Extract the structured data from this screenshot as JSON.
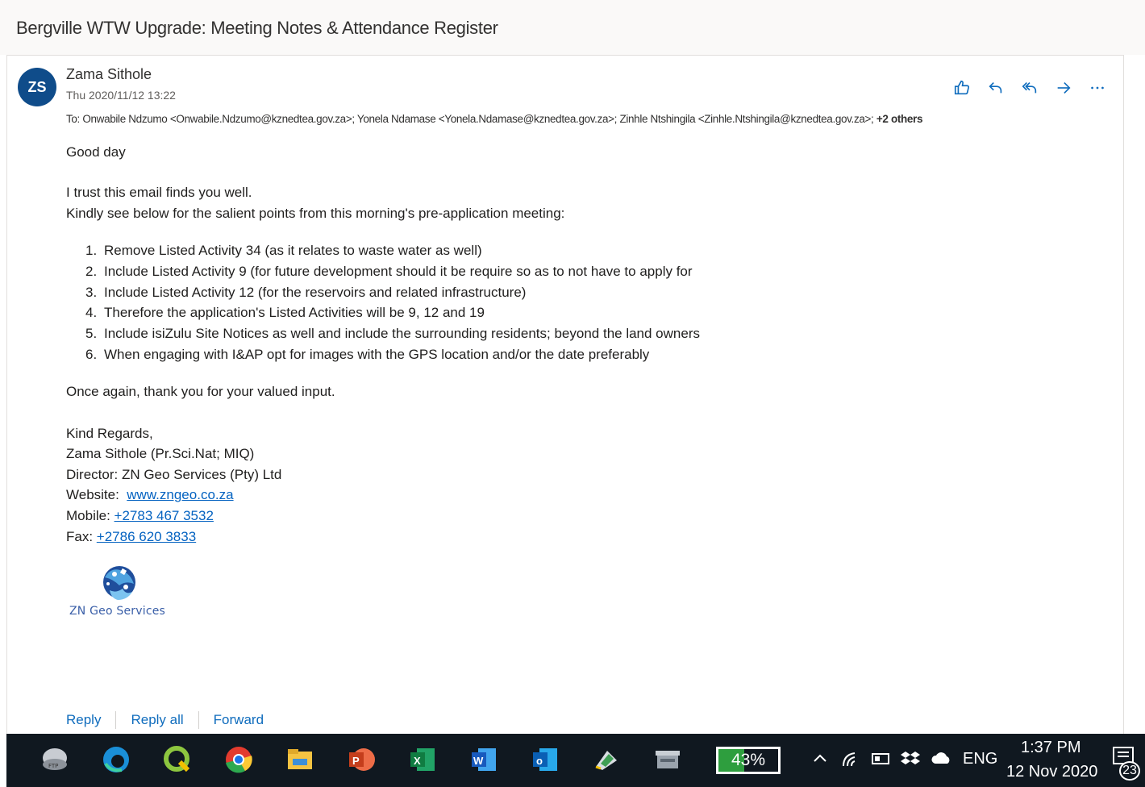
{
  "email": {
    "subject": "Bergville WTW Upgrade: Meeting Notes & Attendance Register",
    "sender_initials": "ZS",
    "sender_name": "Zama Sithole",
    "date": "Thu 2020/11/12 13:22",
    "to_label": "To:",
    "recipients": "Onwabile Ndzumo <Onwabile.Ndzumo@kznedtea.gov.za>; Yonela Ndamase <Yonela.Ndamase@kznedtea.gov.za>; Zinhle Ntshingila <Zinhle.Ntshingila@kznedtea.gov.za>;",
    "others": "+2 others",
    "actions": [
      "like-icon",
      "reply-icon",
      "reply-all-icon",
      "forward-icon",
      "more-icon"
    ],
    "greeting": "Good day",
    "intro_line1": "I trust this email finds you well.",
    "intro_line2": "Kindly see below for the salient points from this morning's pre-application meeting:",
    "items": [
      {
        "num": "1.",
        "text": "Remove Listed Activity 34 (as it relates to waste water as well)"
      },
      {
        "num": "2.",
        "text": "Include Listed Activity 9 (for future development should it be require so as to not have to apply for"
      },
      {
        "num": "3.",
        "text": "Include Listed Activity 12 (for the reservoirs and related infrastructure)"
      },
      {
        "num": "4.",
        "text": "Therefore the application's Listed Activities will be 9, 12 and 19"
      },
      {
        "num": "5.",
        "text": "Include isiZulu Site Notices as well and include the surrounding residents; beyond the land owners"
      },
      {
        "num": "6.",
        "text": "When engaging with I&AP opt for images with the GPS location and/or the date preferably"
      }
    ],
    "closing": "Once again, thank you for your valued input.",
    "signature": {
      "regards": "Kind Regards,",
      "name": "Zama Sithole (Pr.Sci.Nat; MIQ)",
      "title": "Director: ZN Geo Services (Pty) Ltd",
      "website_label": "Website:",
      "website": "www.zngeo.co.za",
      "mobile_label": "Mobile:",
      "mobile": "+2783 467 3532",
      "fax_label": "Fax:",
      "fax": "+2786 620 3833",
      "logo_text": "ZN Geo Services"
    },
    "footer": {
      "reply": "Reply",
      "reply_all": "Reply all",
      "forward": "Forward"
    }
  },
  "taskbar": {
    "apps": [
      "explorer-drive-icon",
      "edge-icon",
      "qgis-icon",
      "chrome-icon",
      "file-explorer-icon",
      "powerpoint-icon",
      "excel-icon",
      "word-icon",
      "outlook-icon",
      "pen-tool-icon",
      "archive-icon"
    ],
    "battery": "43%",
    "battery_level": 0.43,
    "language": "ENG",
    "time": "1:37 PM",
    "date": "12 Nov 2020",
    "notification_count": "23"
  },
  "colors": {
    "accent": "#0f6cbd",
    "avatar": "#0f4c8a",
    "link": "#0563c1",
    "taskbar": "#101820"
  }
}
